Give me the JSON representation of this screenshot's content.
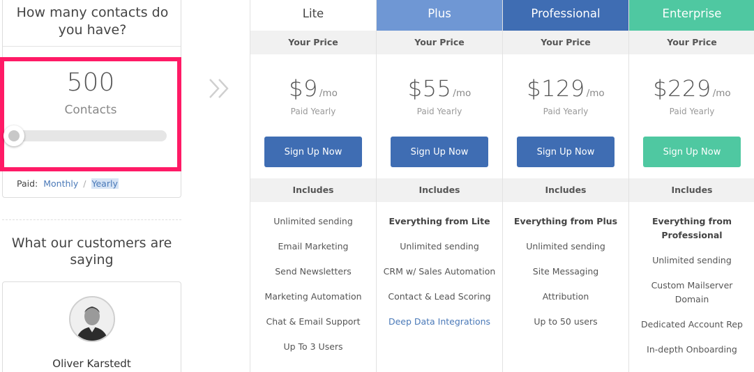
{
  "contacts": {
    "heading": "How many contacts do you have?",
    "count": "500",
    "unit": "Contacts",
    "slider_fraction": 0.0
  },
  "billing": {
    "label": "Paid:",
    "monthly": "Monthly",
    "separator": "/",
    "yearly": "Yearly",
    "selected": "Yearly"
  },
  "testimonials": {
    "heading": "What our customers are saying",
    "name": "Oliver Karstedt"
  },
  "arrow_icon": "double-chevron-right-icon",
  "plans": [
    {
      "name": "Lite",
      "header_bg": "#ffffff",
      "header_color": "#444444",
      "your_price": "Your Price",
      "amount": "$9",
      "per": "/mo",
      "billing_note": "Paid Yearly",
      "button": "Sign Up Now",
      "button_color": "#3f6db3",
      "includes": "Includes",
      "features": [
        {
          "text": "Unlimited sending",
          "style": "normal"
        },
        {
          "text": "Email Marketing",
          "style": "normal"
        },
        {
          "text": "Send Newsletters",
          "style": "normal"
        },
        {
          "text": "Marketing Automation",
          "style": "normal"
        },
        {
          "text": "Chat & Email Support",
          "style": "normal"
        },
        {
          "text": "Up To 3 Users",
          "style": "normal"
        }
      ]
    },
    {
      "name": "Plus",
      "header_bg": "#6f97d4",
      "header_color": "#ffffff",
      "your_price": "Your Price",
      "amount": "$55",
      "per": "/mo",
      "billing_note": "Paid Yearly",
      "button": "Sign Up Now",
      "button_color": "#3f6db3",
      "includes": "Includes",
      "features": [
        {
          "text": "Everything from Lite",
          "style": "bold"
        },
        {
          "text": "Unlimited sending",
          "style": "normal"
        },
        {
          "text": "CRM w/ Sales Automation",
          "style": "normal"
        },
        {
          "text": "Contact & Lead Scoring",
          "style": "normal"
        },
        {
          "text": "Deep Data Integrations",
          "style": "link"
        }
      ]
    },
    {
      "name": "Professional",
      "header_bg": "#3f6db3",
      "header_color": "#ffffff",
      "your_price": "Your Price",
      "amount": "$129",
      "per": "/mo",
      "billing_note": "Paid Yearly",
      "button": "Sign Up Now",
      "button_color": "#3f6db3",
      "includes": "Includes",
      "features": [
        {
          "text": "Everything from Plus",
          "style": "bold"
        },
        {
          "text": "Unlimited sending",
          "style": "normal"
        },
        {
          "text": "Site Messaging",
          "style": "normal"
        },
        {
          "text": "Attribution",
          "style": "normal"
        },
        {
          "text": "Up to 50 users",
          "style": "normal"
        }
      ]
    },
    {
      "name": "Enterprise",
      "header_bg": "#4fc8a1",
      "header_color": "#ffffff",
      "your_price": "Your Price",
      "amount": "$229",
      "per": "/mo",
      "billing_note": "Paid Yearly",
      "button": "Sign Up Now",
      "button_color": "#4fc8a1",
      "includes": "Includes",
      "features": [
        {
          "text": "Everything from Professional",
          "style": "bold"
        },
        {
          "text": "Unlimited sending",
          "style": "normal"
        },
        {
          "text": "Custom Mailserver Domain",
          "style": "normal"
        },
        {
          "text": "Dedicated Account Rep",
          "style": "normal"
        },
        {
          "text": "In-depth Onboarding",
          "style": "normal"
        }
      ]
    }
  ]
}
